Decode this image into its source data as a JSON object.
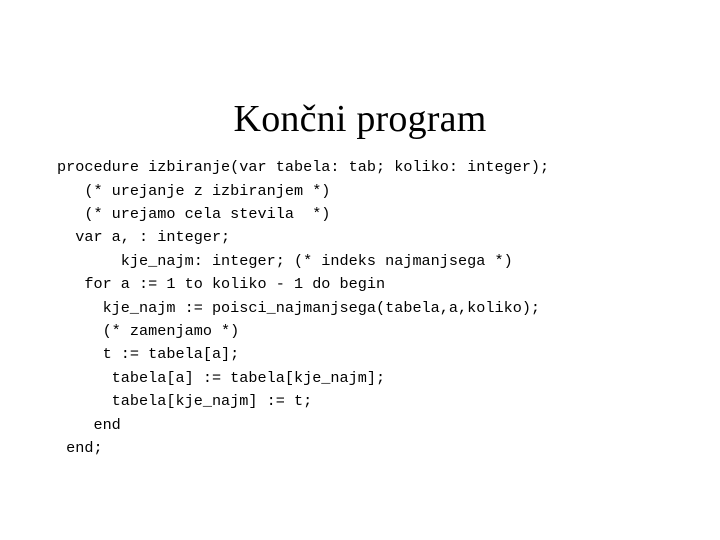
{
  "slide": {
    "title": "Končni program",
    "background_color": "#ffffff",
    "text_color": "#000000",
    "code": {
      "language": "pascal",
      "lines": [
        "procedure izbiranje(var tabela: tab; koliko: integer);",
        "   (* urejanje z izbiranjem *)",
        "   (* urejamo cela stevila  *)",
        "  var a, : integer;",
        "       kje_najm: integer; (* indeks najmanjsega *)",
        "   for a := 1 to koliko - 1 do begin",
        "     kje_najm := poisci_najmanjsega(tabela,a,koliko);",
        "     (* zamenjamo *)",
        "     t := tabela[a];",
        "      tabela[a] := tabela[kje_najm];",
        "      tabela[kje_najm] := t;",
        "    end",
        " end;"
      ]
    }
  }
}
